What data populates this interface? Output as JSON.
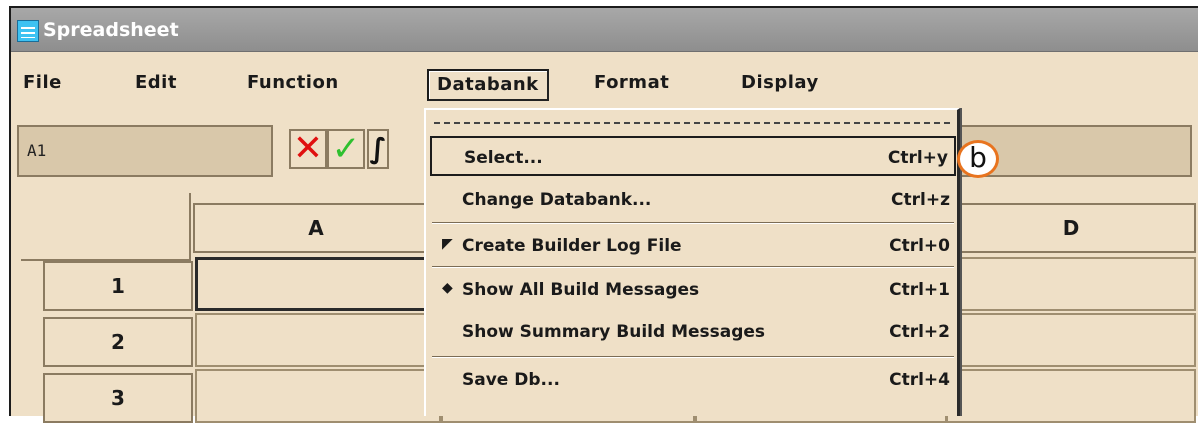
{
  "window": {
    "title": "Spreadsheet",
    "icon": "spreadsheet-icon"
  },
  "menubar": {
    "items": [
      {
        "label": "File"
      },
      {
        "label": "Edit"
      },
      {
        "label": "Function"
      },
      {
        "label": "Databank"
      },
      {
        "label": "Format"
      },
      {
        "label": "Display"
      }
    ]
  },
  "formula_bar": {
    "cell_ref": "A1",
    "cancel_icon": "x-icon",
    "confirm_icon": "check-icon",
    "function_icon": "integral-icon",
    "formula_glyph": "∫",
    "cancel_glyph": "✕",
    "confirm_glyph": "✓"
  },
  "grid": {
    "columns": [
      "A",
      "D"
    ],
    "rows": [
      "1",
      "2",
      "3"
    ]
  },
  "dropdown": {
    "menu": "Databank",
    "items": [
      {
        "label": "Select...",
        "accel": "Ctrl+y",
        "mark": ""
      },
      {
        "label": "Change Databank...",
        "accel": "Ctrl+z",
        "mark": ""
      },
      {
        "label": "Create Builder Log File",
        "accel": "Ctrl+0",
        "mark": "◤"
      },
      {
        "label": "Show All Build Messages",
        "accel": "Ctrl+1",
        "mark": "◆"
      },
      {
        "label": "Show Summary Build Messages",
        "accel": "Ctrl+2",
        "mark": ""
      },
      {
        "label": "Save Db...",
        "accel": "Ctrl+4",
        "mark": ""
      }
    ]
  },
  "callout": {
    "label": "b",
    "color": "#e8741f"
  }
}
